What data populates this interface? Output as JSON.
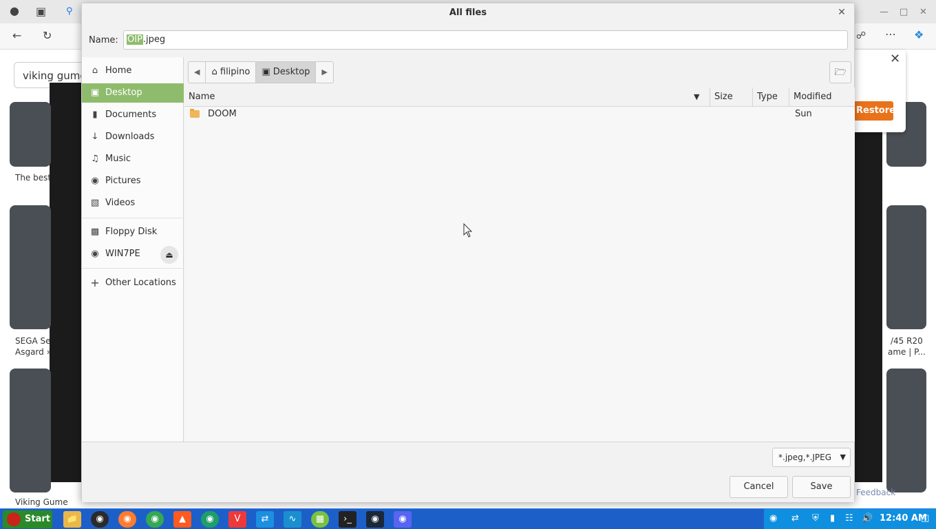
{
  "browser": {
    "search_text": "viking gume",
    "caption_1": "The best",
    "caption_2": "SEGA Se",
    "caption_3": "Asgard »",
    "caption_4": "/45 R20",
    "caption_5": "ame | P...",
    "caption_6": "Viking Gume",
    "restore_label": "Restore",
    "feedback_label": "Feedback"
  },
  "dialog": {
    "title": "All files",
    "name_label": "Name:",
    "name_selected": "OIP",
    "name_rest": ".jpeg",
    "sidebar": {
      "items": [
        {
          "label": "Home",
          "icon": "home-icon"
        },
        {
          "label": "Desktop",
          "icon": "desktop-icon",
          "active": true
        },
        {
          "label": "Documents",
          "icon": "document-icon"
        },
        {
          "label": "Downloads",
          "icon": "download-icon"
        },
        {
          "label": "Music",
          "icon": "music-icon"
        },
        {
          "label": "Pictures",
          "icon": "camera-icon"
        },
        {
          "label": "Videos",
          "icon": "film-icon"
        },
        {
          "label": "Floppy Disk",
          "icon": "floppy-icon"
        },
        {
          "label": "WIN7PE",
          "icon": "disc-icon"
        },
        {
          "label": "Other Locations",
          "icon": "plus-icon"
        }
      ]
    },
    "pathbar": {
      "segments": [
        "filipino",
        "Desktop"
      ]
    },
    "columns": {
      "name": "Name",
      "size": "Size",
      "type": "Type",
      "modified": "Modified"
    },
    "files": [
      {
        "name": "DOOM",
        "size": "",
        "type": "",
        "modified": "Sun"
      }
    ],
    "filter": "*.jpeg,*.JPEG",
    "cancel_label": "Cancel",
    "save_label": "Save"
  },
  "taskbar": {
    "start_label": "Start",
    "clock": "12:40 AM",
    "accent": "#1d5fc9",
    "tray_color": "#0f8fe0"
  }
}
